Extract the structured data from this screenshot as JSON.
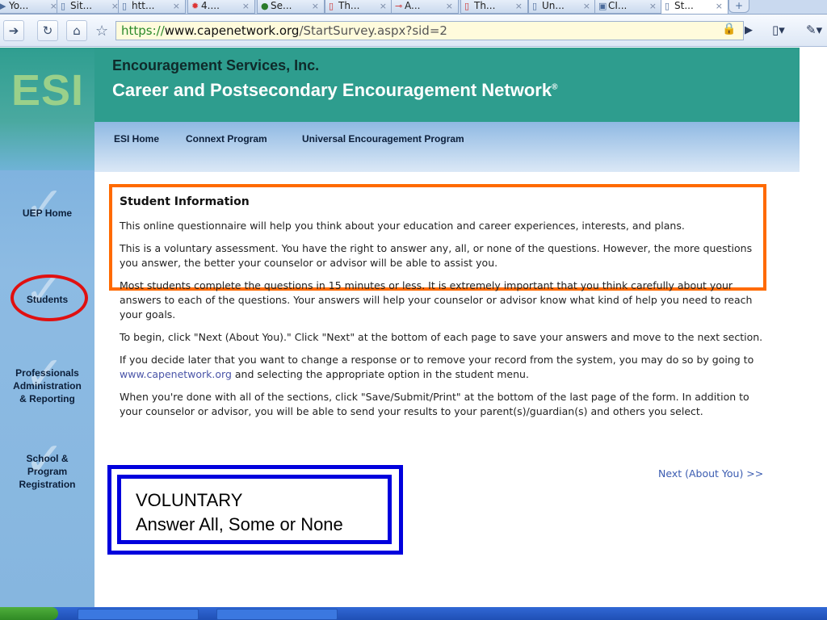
{
  "browser": {
    "tabs": [
      {
        "label": "Yo...",
        "icon": "youtube-icon"
      },
      {
        "label": "Sit...",
        "icon": "page-icon"
      },
      {
        "label": "htt...",
        "icon": "page-icon"
      },
      {
        "label": "4....",
        "icon": "gear-icon"
      },
      {
        "label": "Se...",
        "icon": "globe-icon"
      },
      {
        "label": "Th...",
        "icon": "page-icon"
      },
      {
        "label": "A...",
        "icon": "key-icon"
      },
      {
        "label": "Th...",
        "icon": "page-icon"
      },
      {
        "label": "Un...",
        "icon": "page-icon"
      },
      {
        "label": "CI...",
        "icon": "computer-icon"
      },
      {
        "label": "St...",
        "icon": "page-icon",
        "active": true
      }
    ],
    "address": {
      "scheme": "https://",
      "host": "www.capenetwork.org",
      "path": "/StartSurvey.aspx?sid=2"
    }
  },
  "site": {
    "logo": "ESI",
    "org_name": "Encouragement Services, Inc.",
    "site_name": "Career and Postsecondary Encouragement Network",
    "registered_mark": "®",
    "nav": [
      "ESI Home",
      "Connext Program",
      "Universal Encouragement Program"
    ]
  },
  "sidebar": {
    "uep_home": "UEP Home",
    "students": "Students",
    "professionals": [
      "Professionals",
      "Administration",
      "& Reporting"
    ],
    "school": [
      "School &",
      "Program",
      "Registration"
    ]
  },
  "content": {
    "heading": "Student Information",
    "p1": "This online questionnaire will help you think about your education and career experiences, interests, and plans.",
    "p2": "This is a voluntary assessment. You have the right to answer any, all, or none of the questions. However, the more questions you answer, the better your counselor or advisor will be able to assist you.",
    "p3": "Most students complete the questions in 15 minutes or less. It is extremely important that you think carefully about your answers to each of the questions. Your answers will help your counselor or advisor know what kind of help you need to reach your goals.",
    "p4": "To begin, click \"Next (About You).\" Click \"Next\" at the bottom of each page to save your answers and move to the next section.",
    "p5_before": "If you decide later that you want to change a response or to remove your record from the system, you may do so by going to",
    "p5_link": "www.capenetwork.org",
    "p5_after": "and selecting the appropriate option in the student menu.",
    "p6": "When you're done with all of the sections, click \"Save/Submit/Print\" at the bottom of the last page of the form. In addition to your counselor or advisor, you will be able to send your results to your parent(s)/guardian(s) and others you select.",
    "next_link": "Next (About You) >>"
  },
  "annotation": {
    "line1": "VOLUNTARY",
    "line2": "Answer All, Some or None"
  },
  "colors": {
    "header_teal": "#2e9d8e",
    "orange_highlight": "#ff6a00",
    "blue_highlight": "#0000dd",
    "red_circle": "#e01010"
  }
}
